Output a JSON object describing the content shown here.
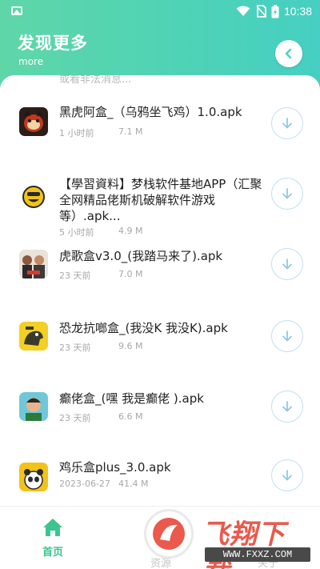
{
  "status_bar": {
    "time": "10:38"
  },
  "header": {
    "title": "发现更多",
    "subtitle": "more"
  },
  "peek_text": "或看非法消息...",
  "items": [
    {
      "title": "黑虎阿盒_（乌鸦坐飞鸡）1.0.apk",
      "time": "1 小时前",
      "size": "7.1 M",
      "icon": "black-tiger-app-icon"
    },
    {
      "title": "【學習資料】梦栈软件基地APP（汇聚全网精品佬斯机破解软件游戏等）.apk...",
      "time": "5 小时前",
      "size": "4.9 M",
      "icon": "yellow-face-app-icon"
    },
    {
      "title": "虎歌盒v3.0_(我踏马来了).apk",
      "time": "23 天前",
      "size": "7.0 M",
      "icon": "huge-box-app-icon"
    },
    {
      "title": "恐龙抗啷盒_(我没K 我没K).apk",
      "time": "23 天前",
      "size": "9.6 M",
      "icon": "dino-box-app-icon"
    },
    {
      "title": "癫佬盒_(嘿 我是癫佬 ).apk",
      "time": "23 天前",
      "size": "6.6 M",
      "icon": "crazy-guy-app-icon"
    },
    {
      "title": "鸡乐盒plus_3.0.apk",
      "time": "2023-06-27",
      "size": "41.4 M",
      "icon": "panda-box-app-icon"
    }
  ],
  "nav": {
    "home": "首页",
    "mid": "资源",
    "right": "关于"
  },
  "watermark": {
    "text": "飞翔下载",
    "url": "WWW.FXXZ.COM"
  },
  "colors": {
    "accent": "#3cc58f",
    "header_start": "#5fd6a8",
    "header_end": "#46cfc2",
    "download_ring": "#bfe1f0",
    "download_arrow": "#8fc9e6"
  }
}
